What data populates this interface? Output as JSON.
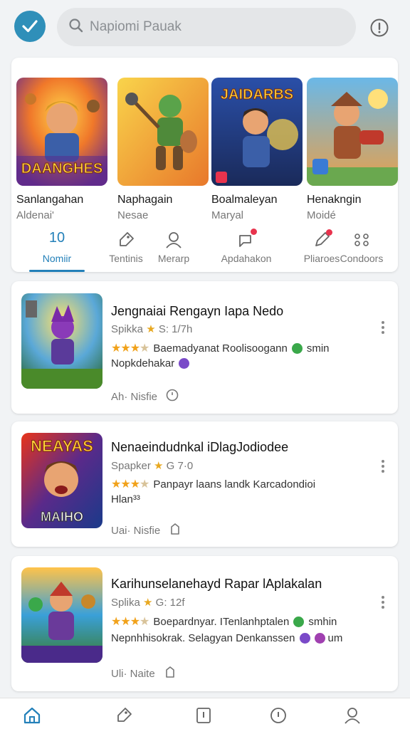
{
  "search": {
    "placeholder": "Napiomi Pauak"
  },
  "featured": [
    {
      "name": "Sanlangahan",
      "sub": "Aldenai'"
    },
    {
      "name": "Naphagain",
      "sub": "Nesae"
    },
    {
      "name": "Boalmaleyan",
      "sub": "Maryal"
    },
    {
      "name": "Henakngin",
      "sub": "Moidé"
    }
  ],
  "featured_art_text": {
    "game1": "DAANGHES",
    "game3": "JAIDARBS"
  },
  "tabs": [
    {
      "label": "Nomiir",
      "icon": "home-number-icon",
      "value": "10",
      "active": true
    },
    {
      "label": "Tentinis",
      "icon": "tag-icon"
    },
    {
      "label": "Merarp",
      "icon": "person-icon"
    },
    {
      "label": "Apdahakon",
      "icon": "message-icon",
      "badge": true
    },
    {
      "label": "Pliaroes",
      "icon": "pencil-icon",
      "badge": true
    },
    {
      "label": "Condoors",
      "icon": "controller-icon"
    }
  ],
  "cards": [
    {
      "title": "Jengnaiai Rengayn Iapa Nedo",
      "dev": "Spikka",
      "meta": "S: 1/7h",
      "rating": 3.5,
      "desc1": "Baemadyanat Roolisoogann",
      "desc1_tail": "smin",
      "desc2": "Nopkdehakar",
      "foot": "Ah· Nisfie",
      "foot_icon": "clock-icon"
    },
    {
      "title": "Nenaeindudnkal iDlagJodiodee",
      "dev": "Spapker",
      "meta": "G 7·0",
      "rating": 3.5,
      "desc1": "Panpayr laans landk Karcadondioi",
      "desc1_tail": "",
      "desc2": "Hlan³³",
      "foot": "Uai· Nisfie",
      "foot_icon": "bookmark-icon",
      "art_text": {
        "top": "NEAYAS",
        "bottom": "MAIHO"
      }
    },
    {
      "title": "Karihunselanehayd Rapar lAplakalan",
      "dev": "Splika",
      "meta": "G: 12f",
      "rating": 3.5,
      "desc1": "Boepardnyar. ITenlanhptalen",
      "desc1_tail": "smhin",
      "desc2": "Nepnhhisokrak. Selagyan Denkanssen",
      "desc2_tail": "um",
      "foot": "Uli· Naite",
      "foot_icon": "bookmark-icon"
    }
  ],
  "bottom_nav": [
    "home-icon",
    "tag-icon",
    "info-square-icon",
    "compass-icon",
    "profile-icon"
  ],
  "colors": {
    "accent": "#2380b9",
    "logo": "#2f8fb9",
    "badge": "#e8334d",
    "star": "#f1a21b"
  }
}
